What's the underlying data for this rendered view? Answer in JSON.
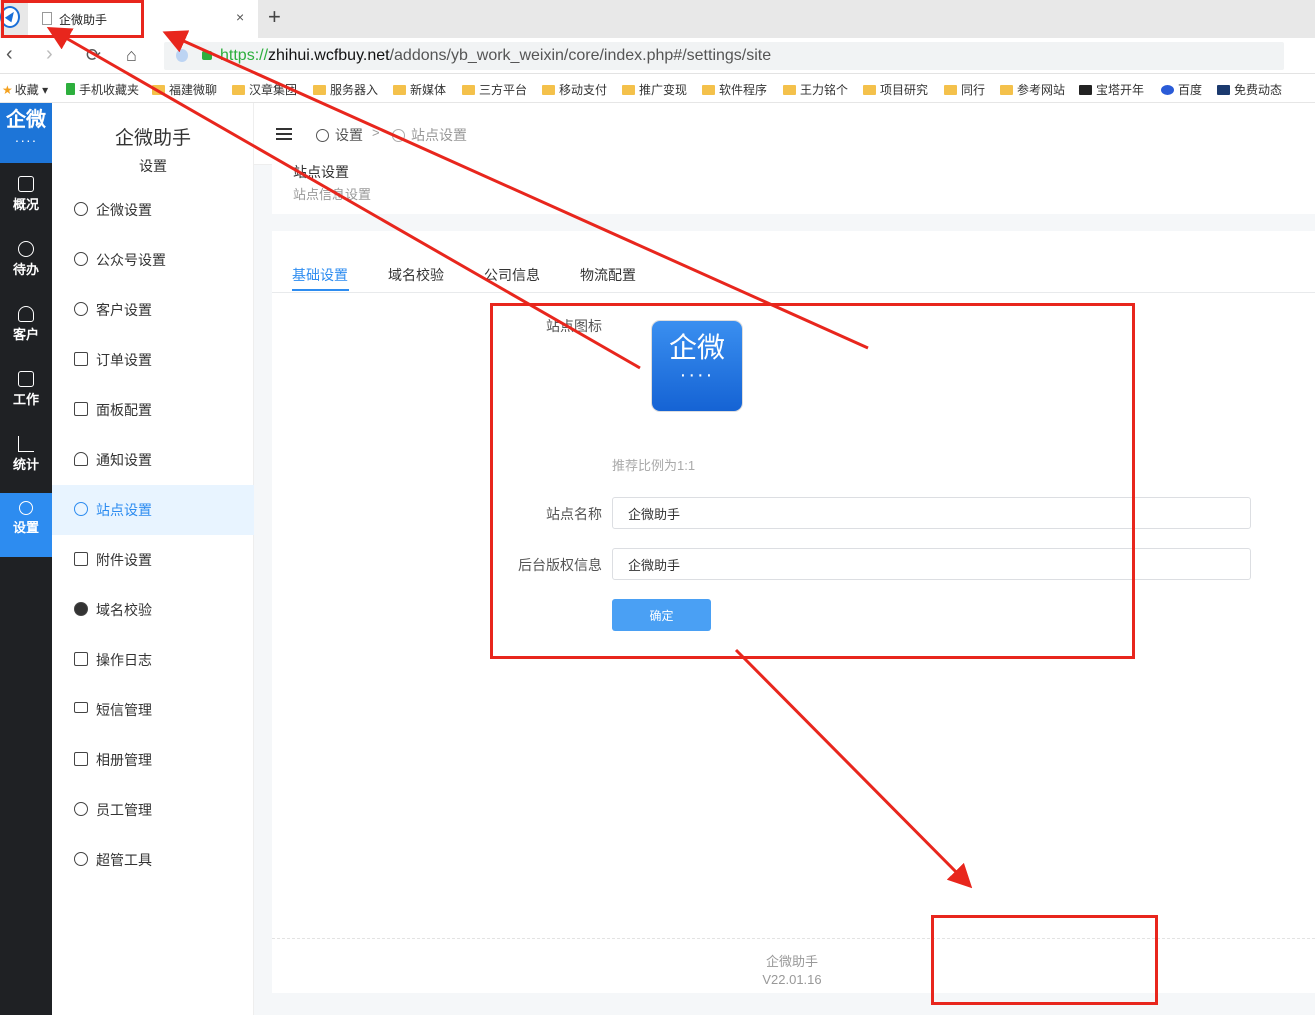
{
  "browser": {
    "tab_title": "企微助手",
    "tab_close": "×",
    "tab_new": "+",
    "url_scheme": "https://",
    "url_host": "zhihui.wcfbuy.net",
    "url_path": "/addons/yb_work_weixin/core/index.php#/settings/site",
    "bookmarks": [
      "收藏",
      "手机收藏夹",
      "福建微聊",
      "汉章集团",
      "服务器入",
      "新媒体",
      "三方平台",
      "移动支付",
      "推广变现",
      "软件程序",
      "王力铭个",
      "项目研究",
      "同行",
      "参考网站",
      "宝塔开年",
      "百度",
      "免费动态"
    ]
  },
  "rail": {
    "logo_text": "企微",
    "logo_dots": "····",
    "items": [
      {
        "label": "概况",
        "icon": "chart-line-icon"
      },
      {
        "label": "待办",
        "icon": "clock-icon"
      },
      {
        "label": "客户",
        "icon": "user-icon"
      },
      {
        "label": "工作",
        "icon": "briefcase-icon"
      },
      {
        "label": "统计",
        "icon": "stats-icon"
      },
      {
        "label": "设置",
        "icon": "gear-icon"
      }
    ]
  },
  "submenu": {
    "title": "企微助手",
    "subtitle": "设置",
    "items": [
      {
        "label": "企微设置"
      },
      {
        "label": "公众号设置"
      },
      {
        "label": "客户设置"
      },
      {
        "label": "订单设置"
      },
      {
        "label": "面板配置"
      },
      {
        "label": "通知设置"
      },
      {
        "label": "站点设置"
      },
      {
        "label": "附件设置"
      },
      {
        "label": "域名校验"
      },
      {
        "label": "操作日志"
      },
      {
        "label": "短信管理"
      },
      {
        "label": "相册管理"
      },
      {
        "label": "员工管理"
      },
      {
        "label": "超管工具"
      }
    ]
  },
  "breadcrumb": {
    "item1": "设置",
    "sep": ">",
    "item2": "站点设置"
  },
  "page_header": {
    "title": "站点设置",
    "subtitle": "站点信息设置"
  },
  "tabs": [
    "基础设置",
    "域名校验",
    "公司信息",
    "物流配置"
  ],
  "form": {
    "icon_label": "站点图标",
    "icon_text": "企微",
    "icon_dots": "····",
    "hint": "推荐比例为1:1",
    "name_label": "站点名称",
    "name_value": "企微助手",
    "copyright_label": "后台版权信息",
    "copyright_value": "企微助手",
    "submit": "确定"
  },
  "footer": {
    "name": "企微助手",
    "version": "V22.01.16"
  },
  "colors": {
    "primary": "#2d8cf0",
    "rail_bg": "#1f2124",
    "annotation": "#e8261d"
  }
}
